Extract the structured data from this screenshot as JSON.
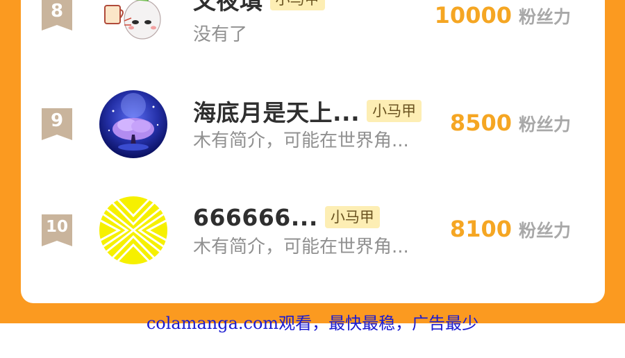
{
  "list": {
    "rows": [
      {
        "rank": "8",
        "name": "又夜填",
        "tag": "小马甲",
        "bio": "没有了",
        "fans_count": "10000",
        "fans_unit": "粉丝力",
        "avatar_icon": "radish-cartoon-avatar"
      },
      {
        "rank": "9",
        "name": "海底月是天上...",
        "tag": "小马甲",
        "bio": "木有简介，可能在世界角...",
        "fans_count": "8500",
        "fans_unit": "粉丝力",
        "avatar_icon": "purple-tree-moon-avatar"
      },
      {
        "rank": "10",
        "name": "666666...",
        "tag": "小马甲",
        "bio": "木有简介，可能在世界角...",
        "fans_count": "8100",
        "fans_unit": "粉丝力",
        "avatar_icon": "yellow-pattern-avatar"
      }
    ]
  },
  "footer": {
    "link_text": "colamanga.com观看，最快最稳，广告最少"
  },
  "colors": {
    "frame": "#fb9a20",
    "badge": "#c9b49c",
    "fans": "#f5a623",
    "tag_bg": "#fdeeb4",
    "footer_link": "#1b1bd0"
  }
}
